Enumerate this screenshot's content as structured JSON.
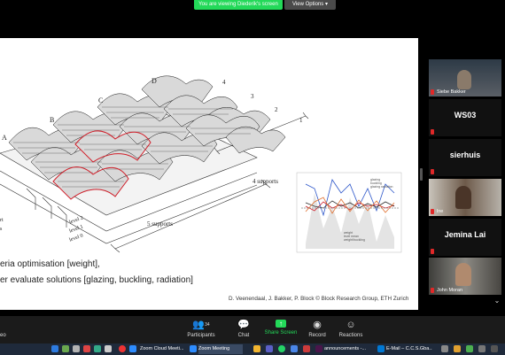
{
  "top": {
    "viewing": "You are viewing Diederik's screen",
    "view_options": "View Options ▾"
  },
  "slide": {
    "labels": {
      "A": "A",
      "B": "B",
      "C": "C",
      "D": "D",
      "n4": "4",
      "n3": "3",
      "n2": "2",
      "n1": "1"
    },
    "supports4": "4 supports",
    "supports5": "5 supports",
    "level2": "level 2",
    "level1": "level 1",
    "level0": "level 0",
    "left_rt": "rt",
    "left_s": "s",
    "bullet1": "eria optimisation [weight],",
    "bullet2": "er evaluate solutions [glazing, buckling, radiation]",
    "credit": "D. Veenendaal, J. Bakker, P. Block © Block Research Group, ETH Zurich",
    "inset_legend": [
      "glazing",
      "buckling",
      "glazing radiation"
    ],
    "inset_legend2": [
      "weight",
      "level mean",
      "weight/buckling"
    ]
  },
  "participants": [
    {
      "name": "Siebe Bakker",
      "kind": "video"
    },
    {
      "name": "WS03",
      "kind": "text"
    },
    {
      "name": "sierhuis",
      "kind": "text"
    },
    {
      "name": "lne",
      "kind": "video"
    },
    {
      "name": "Jemina Lai",
      "kind": "text"
    },
    {
      "name": "John Moran",
      "kind": "video"
    }
  ],
  "controls": {
    "participants_count": "34",
    "participants": "Participants",
    "chat": "Chat",
    "share": "Share Screen",
    "record": "Record",
    "reactions": "Reactions",
    "left_cut": "eo",
    "chevron": "⌃"
  },
  "taskbar": {
    "zoom_cloud": "Zoom Cloud Meeti...",
    "zoom_meeting": "Zoom Meeting",
    "announcements": "announcements -...",
    "email": "E-Mail – C.C.S.Gba..."
  },
  "colors": {
    "share_green": "#23d959",
    "mic_red": "#e02828",
    "accent_red": "#d11f2a"
  }
}
